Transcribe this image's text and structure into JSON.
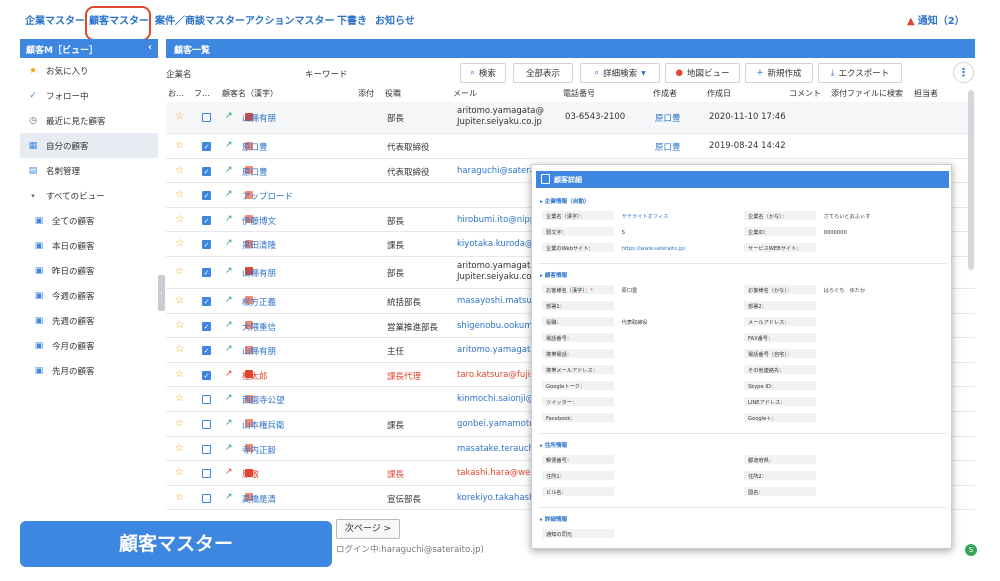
{
  "nav": {
    "tabs": [
      "企業マスター",
      "顧客マスター",
      "案件／商談マスター",
      "アクションマスター",
      "下書き",
      "お知らせ"
    ],
    "notice": "通知（2）"
  },
  "sidebar": {
    "title": "顧客M［ビュー］",
    "items": [
      "お気に入り",
      "フォロー中",
      "最近に見た顧客",
      "自分の顧客",
      "名刺管理",
      "すべてのビュー",
      "全ての顧客",
      "本日の顧客",
      "昨日の顧客",
      "今週の顧客",
      "先週の顧客",
      "今月の顧客",
      "先月の顧客"
    ]
  },
  "main": {
    "title": "顧客一覧",
    "labels": {
      "company": "企業名",
      "keyword": "キーワード"
    },
    "buttons": {
      "search": "検索",
      "show_all": "全部表示",
      "advanced": "詳細検索",
      "map": "地図ビュー",
      "new": "新規作成",
      "export": "エクスポート"
    },
    "columns": [
      "お…",
      "フ…",
      "顧客名（漢字）",
      "添付",
      "役職",
      "メール",
      "電話番号",
      "作成者",
      "作成日",
      "コメント",
      "添付ファイルに検索",
      "担当者"
    ],
    "rows": [
      {
        "name": "山縣有朋",
        "role": "部長",
        "mail1": "aritomo.yamagata@",
        "mail2": "Jupiter.seiyaku.co.jp",
        "tel": "03-6543-2100",
        "creator": "原口豊",
        "date": "2020-11-10 17:46"
      },
      {
        "name": "原口豊",
        "role": "代表取締役",
        "mail": "",
        "creator": "原口豊",
        "date": "2019-08-24 14:42"
      },
      {
        "name": "原口豊",
        "role": "代表取締役",
        "mail": "haraguchi@satera"
      },
      {
        "name": "アップロード",
        "role": "",
        "mail": ""
      },
      {
        "name": "伊藤博文",
        "role": "部長",
        "mail": "hirobumi.ito@nipp"
      },
      {
        "name": "黒田清隆",
        "role": "課長",
        "mail": "kiyotaka.kuroda@"
      },
      {
        "name": "山縣有朋",
        "role": "部長",
        "mail1": "aritomo.yamagata",
        "mail2": "Jupiter.seiyaku.co.jp"
      },
      {
        "name": "松方正義",
        "role": "統括部長",
        "mail": "masayoshi.matsuk"
      },
      {
        "name": "大隈重信",
        "role": "営業推進部長",
        "mail": "shigenobu.ookuma"
      },
      {
        "name": "山縣有朋",
        "role": "主任",
        "mail": "aritomo.yamagata"
      },
      {
        "name": "桂太郎",
        "role": "課長代理",
        "mail": "taro.katsura@fujis"
      },
      {
        "name": "西園寺公望",
        "role": "",
        "mail": "kinmochi.saionji@"
      },
      {
        "name": "山本権兵衛",
        "role": "課長",
        "mail": "gonbei.yamamoto"
      },
      {
        "name": "寺内正毅",
        "role": "",
        "mail": "masatake.terauch"
      },
      {
        "name": "原敬",
        "role": "課長",
        "mail": "takashi.hara@web"
      },
      {
        "name": "高橋是清",
        "role": "宣伝部長",
        "mail": "korekiyo.takahash"
      }
    ]
  },
  "footer": {
    "big_label": "顧客マスター",
    "next": "次ページ >",
    "login": "ログイン中:haraguchi@sateraito.jp)"
  },
  "popup": {
    "title": "顧客詳細",
    "sections": {
      "company": "企業情報（自動）",
      "customer": "顧客情報",
      "address": "住所情報",
      "detail": "詳細情報"
    },
    "company_fields": {
      "name_kanji_label": "企業名（漢字）：",
      "name_kanji": "サテライトオフィス",
      "name_kana_label": "企業名（かな）：",
      "name_kana": "さてらいとおふぃす",
      "initial_label": "頭文字：",
      "initial": "S",
      "company_id_label": "企業ID：",
      "company_id": "0000000",
      "web_label": "企業のWebサイト：",
      "web": "https://www.sateraito.jp/",
      "service_label": "サービスWEBサイト："
    },
    "customer_fields": {
      "name_kanji_label": "お客様名（漢字）：",
      "name_kanji_req": "*",
      "name_kanji": "原口豊",
      "name_kana_label": "お客様名（かな）：",
      "name_kana": "はらぐち　ゆたか",
      "dept1": "部署1：",
      "dept2": "部署2：",
      "position_label": "役職：",
      "position": "代表取締役",
      "mail": "メールアドレス：",
      "tel": "電話番号：",
      "fax": "FAX番号：",
      "mobile": "携帯電話：",
      "home_tel": "電話番号（自宅）：",
      "mobile_mail": "携帯メールアドレス：",
      "other": "その他連絡先：",
      "gtalk": "Googleトーク：",
      "skype": "Skype ID：",
      "twitter": "ツイッター：",
      "line": "LINEアドレス：",
      "facebook": "Facebook：",
      "gplus": "Google＋："
    },
    "address_fields": {
      "zip": "郵便番号：",
      "pref": "都道府県：",
      "addr1": "住所1：",
      "addr2": "住所2：",
      "building": "ビル名：",
      "country": "国名："
    },
    "detail_fields": {
      "notice": "通知の同元"
    }
  },
  "colors": {
    "accent": "#3d87e0",
    "link": "#2e73c9",
    "alert": "#e2452e",
    "star": "#f1a21a"
  }
}
